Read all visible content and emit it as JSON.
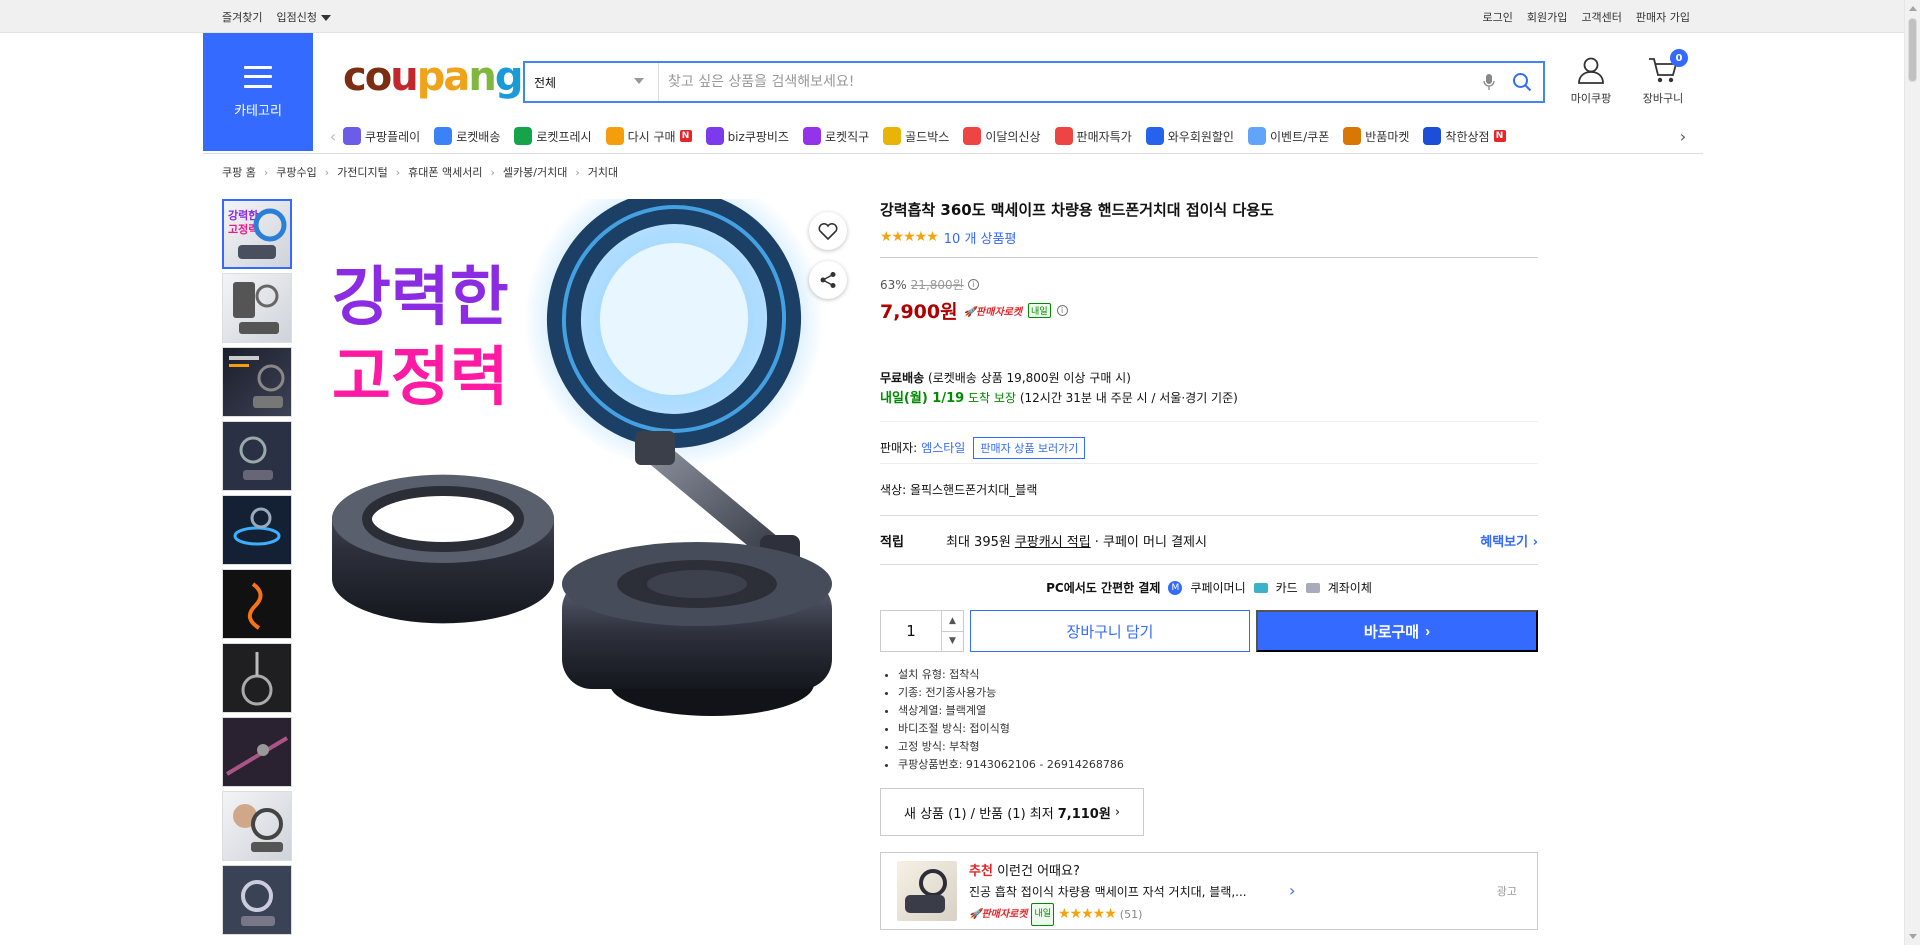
{
  "topbar": {
    "left": [
      "즐겨찾기",
      "입점신청"
    ],
    "right": [
      "로그인",
      "회원가입",
      "고객센터",
      "판매자 가입"
    ]
  },
  "header": {
    "category_label": "카테고리",
    "logo": {
      "c": "c",
      "o": "o",
      "u": "u",
      "p": "p",
      "a": "a",
      "n": "n",
      "g": "g"
    },
    "search_scope": "전체",
    "search_placeholder": "찾고 싶은 상품을 검색해보세요!",
    "mycoupang": "마이쿠팡",
    "cart": "장바구니",
    "cart_count": "0"
  },
  "nav_items": [
    {
      "label": "쿠팡플레이",
      "color": "#6c5ce7"
    },
    {
      "label": "로켓배송",
      "color": "#3b82f6"
    },
    {
      "label": "로켓프레시",
      "color": "#16a34a"
    },
    {
      "label": "다시 구매",
      "color": "#f59e0b"
    },
    {
      "label": "biz쿠팡비즈",
      "color": "#7c3aed"
    },
    {
      "label": "로켓직구",
      "color": "#9333ea"
    },
    {
      "label": "골드박스",
      "color": "#eab308"
    },
    {
      "label": "이달의신상",
      "color": "#ef4444"
    },
    {
      "label": "판매자특가",
      "color": "#ef4444"
    },
    {
      "label": "와우회원할인",
      "color": "#2563eb"
    },
    {
      "label": "이벤트/쿠폰",
      "color": "#60a5fa"
    },
    {
      "label": "반품마켓",
      "color": "#d97706"
    },
    {
      "label": "착한상점",
      "color": "#1d4ed8"
    }
  ],
  "breadcrumb": [
    "쿠팡 홈",
    "쿠팡수입",
    "가전디지털",
    "휴대폰 액세서리",
    "셀카봉/거치대",
    "거치대"
  ],
  "product": {
    "title": "강력흡착 360도 맥세이프 차량용 핸드폰거치대 접이식 다용도",
    "rating_stars": "★★★★★",
    "review_count": "10 개 상품평",
    "discount": "63%",
    "original_price": "21,800원",
    "price": "7,900원",
    "rocket_label": "판매자로켓",
    "tomorrow_tag": "내일",
    "free_ship": "무료배송",
    "free_ship_note": "(로켓배송 상품 19,800원 이상 구매 시)",
    "arrival": "내일(월) 1/19",
    "arrival_guarantee": "도착 보장",
    "arrival_note": "(12시간 31분 내 주문 시 / 서울⋅경기 기준)",
    "seller_label": "판매자:",
    "seller_name": "엠스타일",
    "seller_btn": "판매자 상품 보러가기",
    "color_label": "색상: 올픽스핸드폰거치대_블랙",
    "points_title": "적립",
    "points_text1": "최대 395원",
    "points_link": "쿠팡캐시 적립",
    "points_text2": "· 쿠페이 머니 결제시",
    "points_more": "혜택보기",
    "pay_title": "PC에서도 간편한 결제",
    "pay_options": [
      "쿠페이머니",
      "카드",
      "계좌이체"
    ],
    "quantity": "1",
    "cart_btn": "장바구니 담기",
    "buy_btn": "바로구매",
    "specs": [
      "설치 유형: 접착식",
      "기종: 전기종사용가능",
      "색상계열: 블랙계열",
      "바디조절 방식: 접이식형",
      "고정 방식: 부착형",
      "쿠팡상품번호: 9143062106 - 26914268786"
    ],
    "offer_text": "새 상품 (1) / 반품 (1) 최저",
    "offer_price": "7,110원"
  },
  "recommend": {
    "highlight": "추천",
    "title": "이런건 어때요?",
    "name": "진공 흡착 접이식 차량용 맥세이프 자석 거치대, 블랙,...",
    "rocket": "판매자로켓",
    "tomorrow": "내일",
    "stars": "★★★★★",
    "count": "(51)",
    "ad": "광고"
  },
  "image_text": {
    "line1": "강력한",
    "line2": "고정력"
  }
}
